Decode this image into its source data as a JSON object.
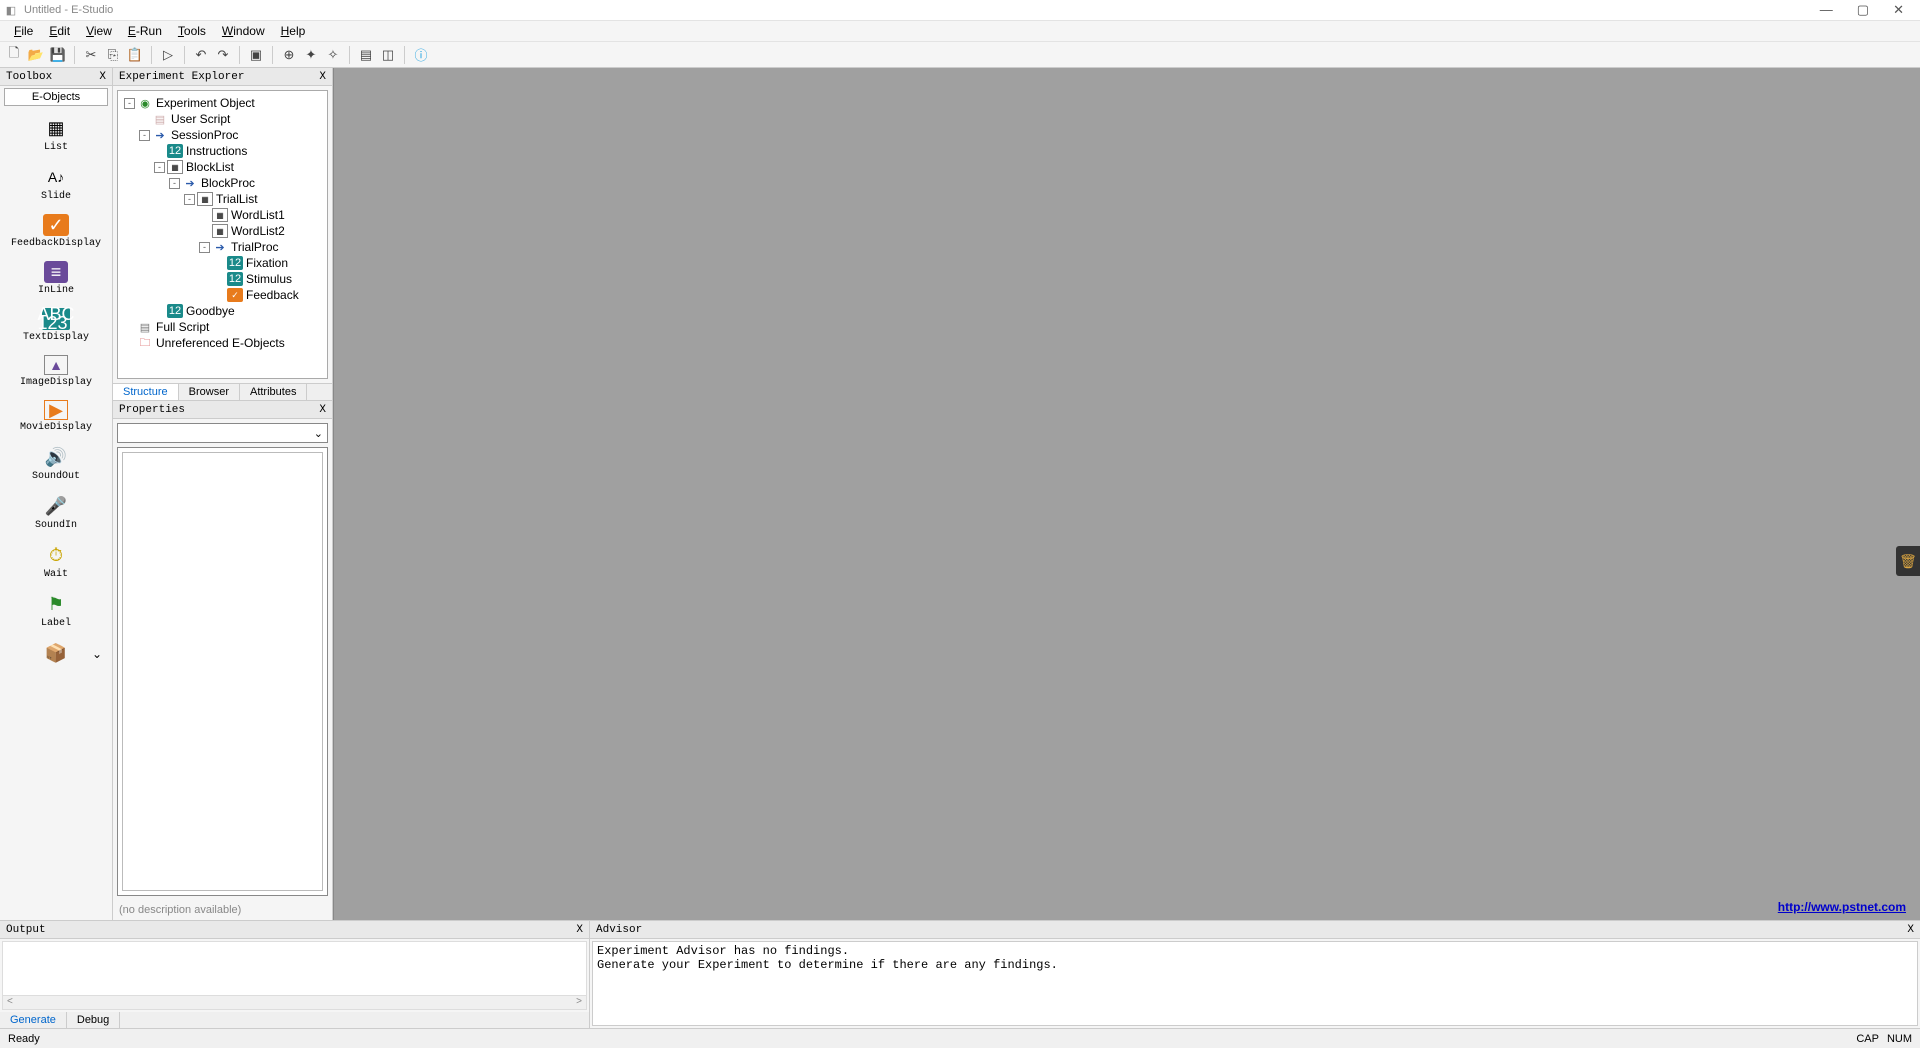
{
  "window": {
    "title": "Untitled - E-Studio"
  },
  "menu": {
    "items": [
      "File",
      "Edit",
      "View",
      "E-Run",
      "Tools",
      "Window",
      "Help"
    ]
  },
  "toolbox": {
    "title": "Toolbox",
    "tab": "E-Objects",
    "items": [
      {
        "label": "List",
        "icon": "list-icon"
      },
      {
        "label": "Slide",
        "icon": "slide-icon"
      },
      {
        "label": "FeedbackDisplay",
        "icon": "feedback-icon"
      },
      {
        "label": "InLine",
        "icon": "inline-icon"
      },
      {
        "label": "TextDisplay",
        "icon": "textdisplay-icon"
      },
      {
        "label": "ImageDisplay",
        "icon": "imagedisplay-icon"
      },
      {
        "label": "MovieDisplay",
        "icon": "moviedisplay-icon"
      },
      {
        "label": "SoundOut",
        "icon": "soundout-icon"
      },
      {
        "label": "SoundIn",
        "icon": "soundin-icon"
      },
      {
        "label": "Wait",
        "icon": "wait-icon"
      },
      {
        "label": "Label",
        "icon": "label-icon"
      },
      {
        "label": "",
        "icon": "package-icon"
      }
    ]
  },
  "explorer": {
    "title": "Experiment Explorer",
    "tabs": [
      "Structure",
      "Browser",
      "Attributes"
    ],
    "tree": [
      {
        "indent": 0,
        "exp": "-",
        "icon": "exp-icon",
        "label": "Experiment Object"
      },
      {
        "indent": 1,
        "exp": "",
        "icon": "script-icon",
        "label": "User Script"
      },
      {
        "indent": 1,
        "exp": "-",
        "icon": "proc-icon",
        "label": "SessionProc"
      },
      {
        "indent": 2,
        "exp": "",
        "icon": "text-icon",
        "label": "Instructions"
      },
      {
        "indent": 2,
        "exp": "-",
        "icon": "list-small-icon",
        "label": "BlockList"
      },
      {
        "indent": 3,
        "exp": "-",
        "icon": "proc-icon",
        "label": "BlockProc"
      },
      {
        "indent": 4,
        "exp": "-",
        "icon": "list-small-icon",
        "label": "TrialList"
      },
      {
        "indent": 5,
        "exp": "",
        "icon": "list-small-icon",
        "label": "WordList1"
      },
      {
        "indent": 5,
        "exp": "",
        "icon": "list-small-icon",
        "label": "WordList2"
      },
      {
        "indent": 5,
        "exp": "-",
        "icon": "proc-icon",
        "label": "TrialProc"
      },
      {
        "indent": 6,
        "exp": "",
        "icon": "text-icon",
        "label": "Fixation"
      },
      {
        "indent": 6,
        "exp": "",
        "icon": "text-icon",
        "label": "Stimulus"
      },
      {
        "indent": 6,
        "exp": "",
        "icon": "feedback-small-icon",
        "label": "Feedback"
      },
      {
        "indent": 2,
        "exp": "",
        "icon": "text-icon",
        "label": "Goodbye"
      },
      {
        "indent": 0,
        "exp": "",
        "icon": "fullscript-icon",
        "label": "Full Script"
      },
      {
        "indent": 0,
        "exp": "",
        "icon": "unref-icon",
        "label": "Unreferenced E-Objects"
      }
    ]
  },
  "properties": {
    "title": "Properties",
    "description": "(no description available)"
  },
  "canvas": {
    "link": "http://www.pstnet.com"
  },
  "output": {
    "title": "Output",
    "tabs": [
      "Generate",
      "Debug"
    ]
  },
  "advisor": {
    "title": "Advisor",
    "text": "Experiment Advisor has no findings.\nGenerate your Experiment to determine if there are any findings."
  },
  "status": {
    "ready": "Ready",
    "cap": "CAP",
    "num": "NUM"
  }
}
